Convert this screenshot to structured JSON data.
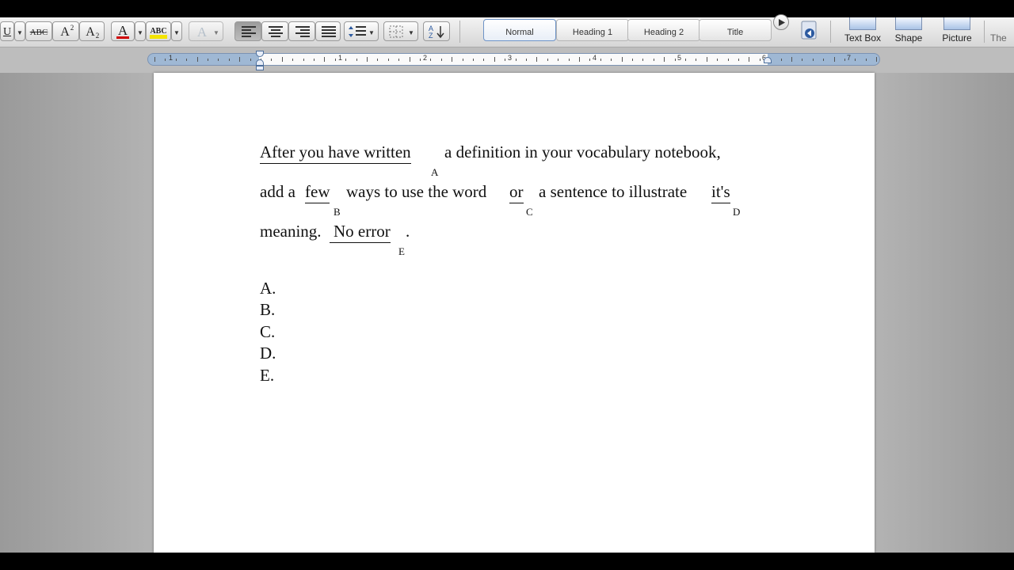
{
  "toolbar": {
    "underline_glyph": "U",
    "strike_label": "ABC",
    "superscript_label": "A",
    "superscript_mark": "2",
    "subscript_label": "A",
    "subscript_mark": "2",
    "font_color_label": "A",
    "highlight_label": "ABC",
    "text_effects_label": "A",
    "icons": [
      "underline-icon",
      "strikethrough-icon",
      "superscript-icon",
      "subscript-icon",
      "font-color-icon",
      "highlight-icon",
      "text-effects-icon",
      "align-left-icon",
      "align-center-icon",
      "align-right-icon",
      "justify-icon",
      "line-spacing-icon",
      "borders-icon",
      "sort-icon"
    ],
    "styles": [
      "Normal",
      "Heading 1",
      "Heading 2",
      "Title"
    ],
    "insert": {
      "text_box": "Text Box",
      "shape": "Shape",
      "picture": "Picture",
      "themes": "The"
    },
    "colors": {
      "accent": "#6d93c7",
      "font_color": "#d00000",
      "highlight": "#f4e400"
    }
  },
  "ruler": {
    "numbers": [
      "1",
      "1",
      "2",
      "3",
      "4",
      "5",
      "6",
      "7"
    ]
  },
  "document": {
    "line1": {
      "u1": "After you have written",
      "t1": "a definition in your vocabulary notebook,",
      "label_a": "A"
    },
    "line2": {
      "t1": "add a",
      "u1": "few",
      "t2": "ways to use the word",
      "u2": "or",
      "t3": "a sentence to illustrate",
      "u3": "it's",
      "label_b": "B",
      "label_c": "C",
      "label_d": "D"
    },
    "line3": {
      "t1": "meaning.",
      "u1": "No error",
      "t2": ".",
      "label_e": "E"
    },
    "options": [
      "A.",
      "B.",
      "C.",
      "D.",
      "E."
    ]
  }
}
